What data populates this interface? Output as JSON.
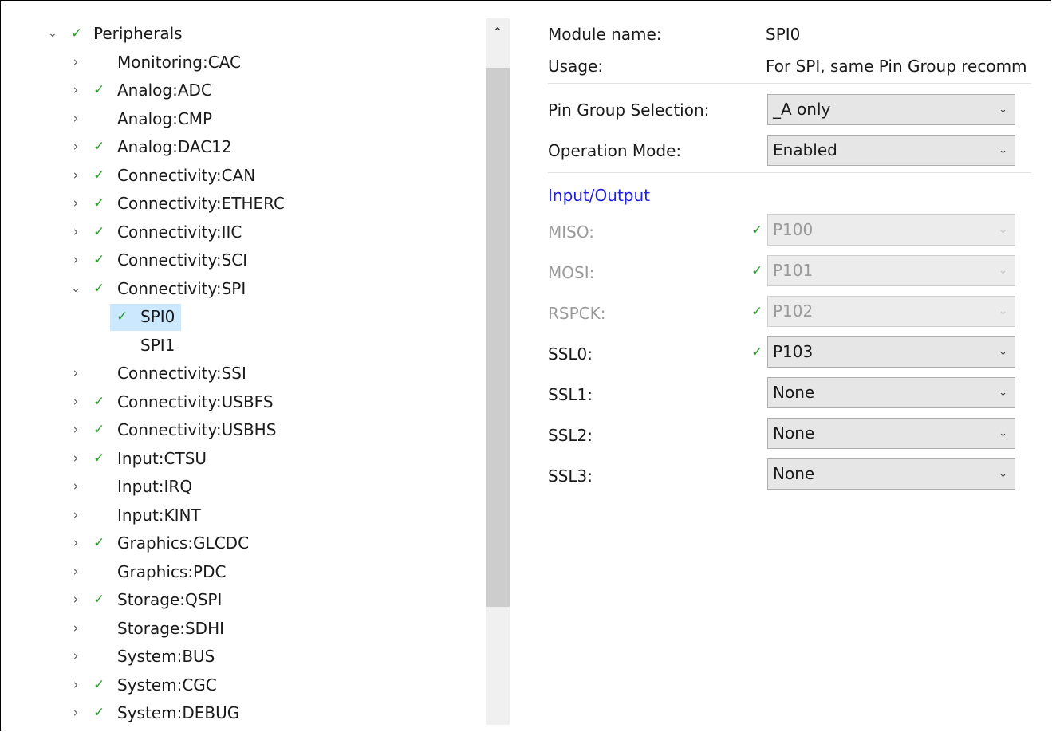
{
  "tree": {
    "root": {
      "label": "Peripherals",
      "checked": true,
      "expanded": true
    },
    "items": [
      {
        "label": "Monitoring:CAC",
        "checked": false
      },
      {
        "label": "Analog:ADC",
        "checked": true
      },
      {
        "label": "Analog:CMP",
        "checked": false
      },
      {
        "label": "Analog:DAC12",
        "checked": true
      },
      {
        "label": "Connectivity:CAN",
        "checked": true
      },
      {
        "label": "Connectivity:ETHERC",
        "checked": true
      },
      {
        "label": "Connectivity:IIC",
        "checked": true
      },
      {
        "label": "Connectivity:SCI",
        "checked": true
      },
      {
        "label": "Connectivity:SPI",
        "checked": true,
        "expanded": true,
        "children": [
          {
            "label": "SPI0",
            "checked": true,
            "selected": true
          },
          {
            "label": "SPI1",
            "checked": false
          }
        ]
      },
      {
        "label": "Connectivity:SSI",
        "checked": false
      },
      {
        "label": "Connectivity:USBFS",
        "checked": true
      },
      {
        "label": "Connectivity:USBHS",
        "checked": true
      },
      {
        "label": "Input:CTSU",
        "checked": true
      },
      {
        "label": "Input:IRQ",
        "checked": false
      },
      {
        "label": "Input:KINT",
        "checked": false
      },
      {
        "label": "Graphics:GLCDC",
        "checked": true
      },
      {
        "label": "Graphics:PDC",
        "checked": false
      },
      {
        "label": "Storage:QSPI",
        "checked": true
      },
      {
        "label": "Storage:SDHI",
        "checked": false
      },
      {
        "label": "System:BUS",
        "checked": false
      },
      {
        "label": "System:CGC",
        "checked": true
      },
      {
        "label": "System:DEBUG",
        "checked": true
      }
    ]
  },
  "properties": {
    "module_name": {
      "label": "Module name:",
      "value": "SPI0"
    },
    "usage": {
      "label": "Usage:",
      "value": "For SPI, same Pin Group recomm"
    },
    "pin_group": {
      "label": "Pin Group Selection:",
      "value": "_A only"
    },
    "operation_mode": {
      "label": "Operation Mode:",
      "value": "Enabled"
    },
    "io_section": "Input/Output",
    "pins": [
      {
        "label": "MISO:",
        "value": "P100",
        "checked": true,
        "disabled": true
      },
      {
        "label": "MOSI:",
        "value": "P101",
        "checked": true,
        "disabled": true
      },
      {
        "label": "RSPCK:",
        "value": "P102",
        "checked": true,
        "disabled": true
      },
      {
        "label": "SSL0:",
        "value": "P103",
        "checked": true,
        "disabled": false
      },
      {
        "label": "SSL1:",
        "value": "None",
        "checked": false,
        "disabled": false
      },
      {
        "label": "SSL2:",
        "value": "None",
        "checked": false,
        "disabled": false
      },
      {
        "label": "SSL3:",
        "value": "None",
        "checked": false,
        "disabled": false
      }
    ]
  },
  "icons": {
    "chevron_right": "›",
    "chevron_down": "⌄",
    "check": "✓",
    "scroll_up": "⌃",
    "combo_arrow": "⌄"
  },
  "colors": {
    "check": "#2a9d2a",
    "section_link": "#1f1fe0",
    "selection": "#cce8ff"
  }
}
